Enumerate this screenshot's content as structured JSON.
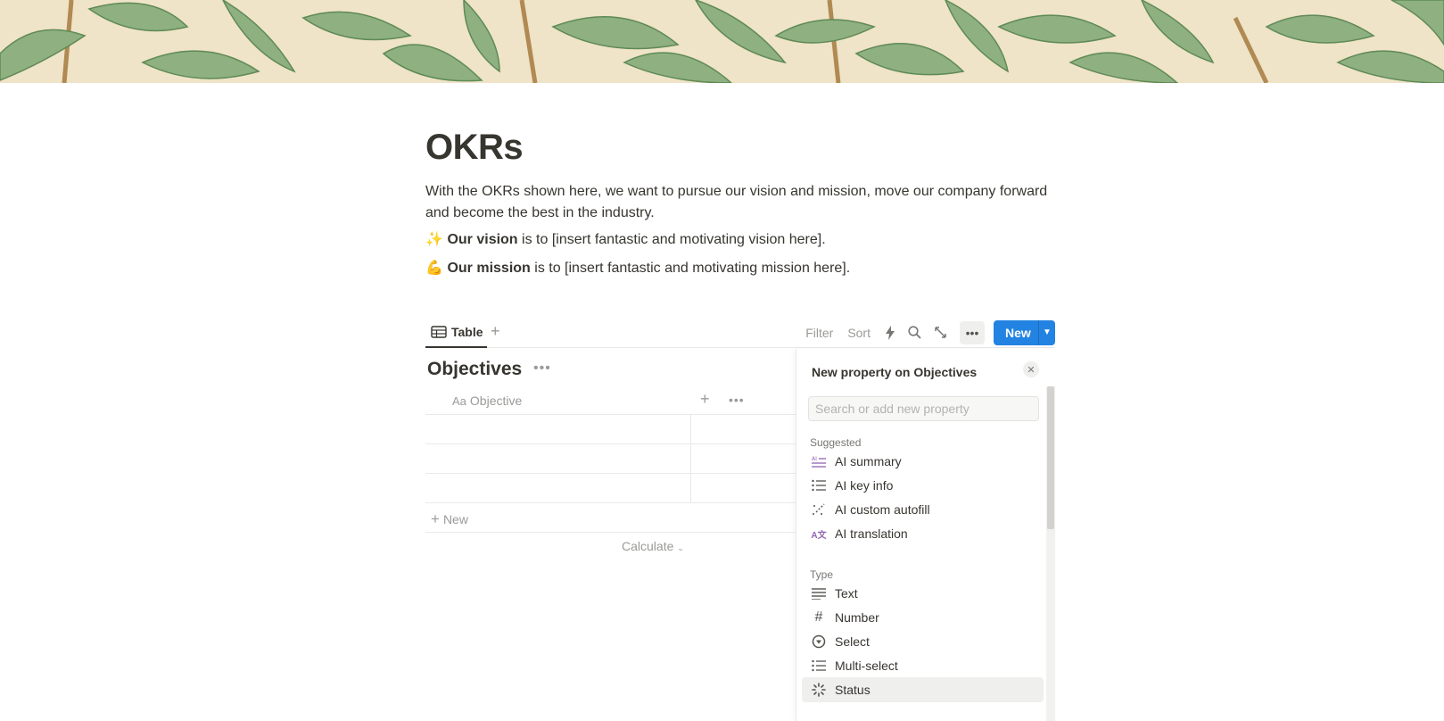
{
  "page": {
    "title": "OKRs",
    "intro": "With the OKRs shown here, we want to pursue our vision and mission, move our company forward and become the best in the industry.",
    "vision": {
      "emoji": "✨",
      "bold": "Our vision",
      "text": " is to [insert fantastic and motivating vision here]."
    },
    "mission": {
      "emoji": "💪",
      "bold": "Our mission",
      "text": " is to [insert fantastic and motivating mission here]."
    }
  },
  "viewbar": {
    "tab_label": "Table",
    "filter": "Filter",
    "sort": "Sort",
    "new_label": "New"
  },
  "database": {
    "title": "Objectives",
    "column_icon": "Aa",
    "column_name": "Objective",
    "rows": [
      "",
      "",
      ""
    ],
    "new_row": "New",
    "calculate": "Calculate"
  },
  "panel": {
    "title": "New property on Objectives",
    "search_placeholder": "Search or add new property",
    "suggested_label": "Suggested",
    "suggested": [
      {
        "label": "AI summary",
        "icon": "ai-summary-icon"
      },
      {
        "label": "AI key info",
        "icon": "list-icon"
      },
      {
        "label": "AI custom autofill",
        "icon": "sparkle-wand-icon"
      },
      {
        "label": "AI translation",
        "icon": "translation-icon"
      }
    ],
    "type_label": "Type",
    "types": [
      {
        "label": "Text",
        "icon": "text-lines-icon"
      },
      {
        "label": "Number",
        "icon": "hash-icon"
      },
      {
        "label": "Select",
        "icon": "select-circle-icon"
      },
      {
        "label": "Multi-select",
        "icon": "list-icon"
      },
      {
        "label": "Status",
        "icon": "status-spinner-icon"
      }
    ]
  },
  "colors": {
    "accent": "#2383e2",
    "text": "#37352f",
    "muted": "#9b9a97"
  }
}
